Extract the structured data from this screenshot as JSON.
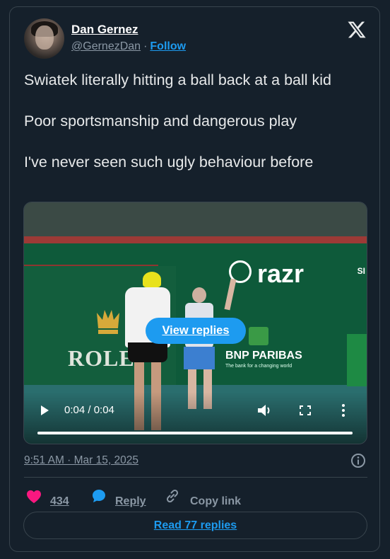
{
  "author": {
    "name": "Dan Gernez",
    "handle": "@GernezDan",
    "separator": "·",
    "follow_label": "Follow"
  },
  "tweet": {
    "lines": [
      "Swiatek literally hitting a ball back at a ball kid",
      "Poor sportsmanship and dangerous play",
      "I've never seen such ugly behaviour before"
    ]
  },
  "media": {
    "view_replies_label": "View replies",
    "time": "0:04 / 0:04",
    "progress": 1.0,
    "scene_text": {
      "rolex": "ROLE",
      "razr": "razr",
      "bnp": "BNP PARIBAS",
      "bnp_tagline": "The bank for a changing world",
      "sponsor_partial": "SI"
    }
  },
  "meta": {
    "timestamp": "9:51 AM · Mar 15, 2025"
  },
  "actions": {
    "likes": "434",
    "reply_label": "Reply",
    "copy_label": "Copy link",
    "read_replies_label": "Read 77 replies"
  },
  "icons": {
    "logo": "x-logo-icon",
    "like": "heart-icon",
    "reply": "reply-bubble-icon",
    "copy": "link-icon",
    "info": "info-icon"
  },
  "colors": {
    "background": "#15202b",
    "accent": "#1d9bf0",
    "like": "#f91880",
    "muted": "#8b98a5"
  }
}
